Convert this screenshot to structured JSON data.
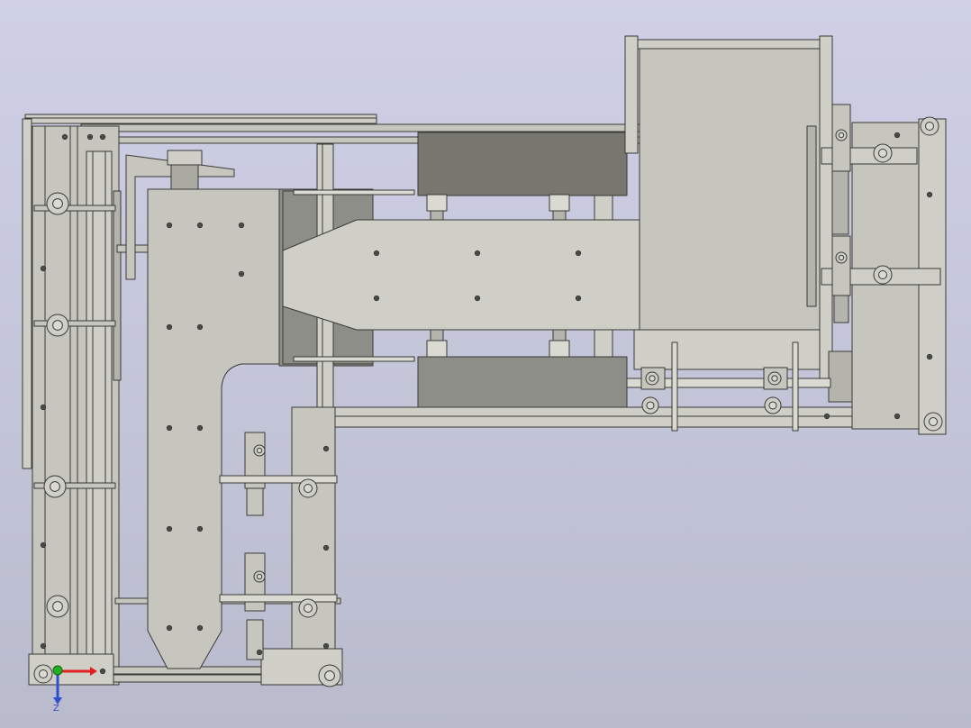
{
  "viewport": {
    "background_top": "#cfd0e6",
    "background_bottom": "#b9bbcd"
  },
  "colors": {
    "part_fill": "#c6c6bf",
    "part_fill_light": "#cfcfc8",
    "part_shade": "#9c9c96",
    "dark_block": "#77776f",
    "dark_panel": "#8e8e88",
    "edge": "#3a3a36",
    "hole": "#4a4a46",
    "axis_x": "#e02020",
    "axis_y": "#20b020",
    "axis_z": "#3050d0"
  },
  "triad": {
    "z_label": "Z"
  }
}
